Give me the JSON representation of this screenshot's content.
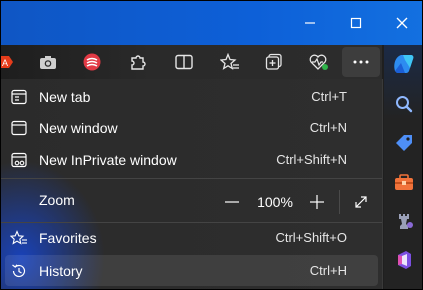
{
  "window": {
    "minimize_icon": "minimize-icon",
    "maximize_icon": "maximize-icon",
    "close_icon": "close-icon"
  },
  "toolbar": {
    "icons": [
      "acrobat-icon",
      "camera-icon",
      "extension-red-icon",
      "extensions-icon",
      "split-screen-icon",
      "favorites-icon",
      "collections-icon",
      "browser-essentials-icon",
      "more-icon"
    ]
  },
  "menu": {
    "new_tab": {
      "label": "New tab",
      "shortcut": "Ctrl+T"
    },
    "new_window": {
      "label": "New window",
      "shortcut": "Ctrl+N"
    },
    "new_inprivate": {
      "label": "New InPrivate window",
      "shortcut": "Ctrl+Shift+N"
    },
    "zoom": {
      "label": "Zoom",
      "value": "100%",
      "minus": "—",
      "plus": "+"
    },
    "favorites": {
      "label": "Favorites",
      "shortcut": "Ctrl+Shift+O"
    },
    "history": {
      "label": "History",
      "shortcut": "Ctrl+H"
    }
  },
  "sidebar": {
    "icons": [
      "copilot-icon",
      "search-icon",
      "tag-icon",
      "toolbox-icon",
      "chess-icon",
      "office-icon"
    ]
  },
  "colors": {
    "accent": "#0f56c4",
    "menu_bg": "#2b2b2b",
    "text": "#ffffff"
  }
}
